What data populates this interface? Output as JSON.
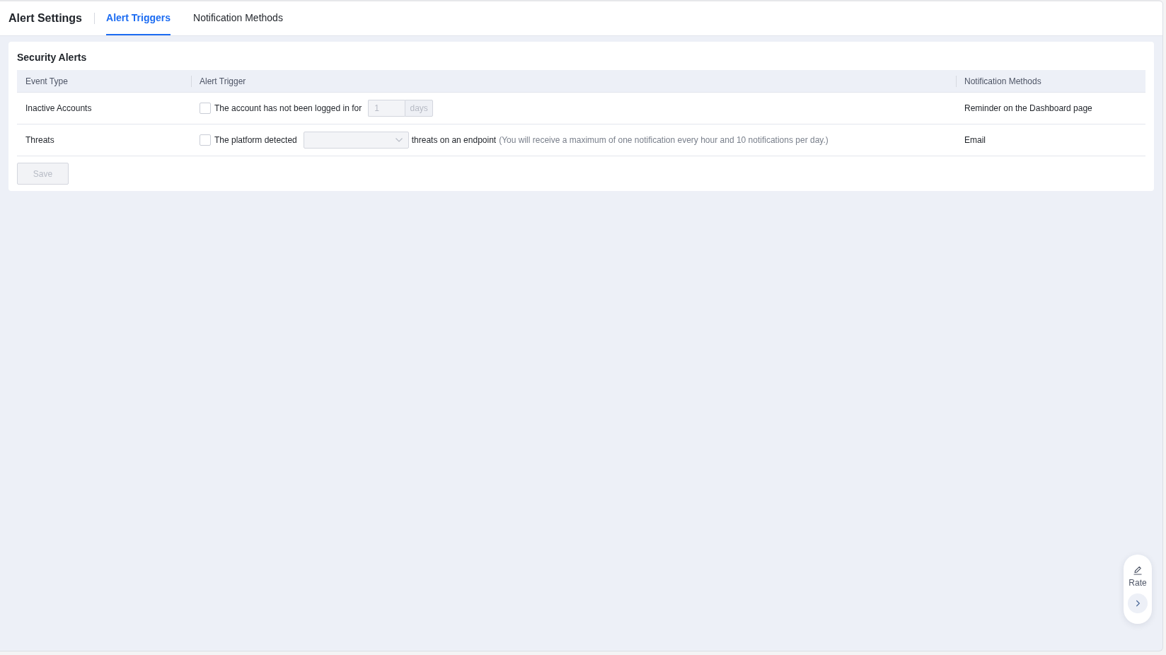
{
  "header": {
    "title": "Alert Settings",
    "tabs": [
      {
        "label": "Alert Triggers",
        "selected": true
      },
      {
        "label": "Notification Methods",
        "selected": false
      }
    ]
  },
  "card": {
    "title": "Security Alerts",
    "table": {
      "columns": [
        "Event Type",
        "Alert Trigger",
        "Notification Methods"
      ],
      "rows": [
        {
          "event_type": "Inactive Accounts",
          "trigger": {
            "kind": "input",
            "checked": false,
            "label": "The account has not been logged in for",
            "input": {
              "value": "1",
              "disabled": true
            },
            "unit": "days"
          },
          "notification": "Reminder on the Dashboard page"
        },
        {
          "event_type": "Threats",
          "trigger": {
            "kind": "select",
            "checked": false,
            "label": "The platform detected",
            "select": {
              "disabled": true
            },
            "suffix": "threats on an endpoint",
            "note": "(You will receive a maximum of one notification every hour and 10 notifications per day.)"
          },
          "notification": "Email"
        }
      ]
    },
    "save_button": {
      "label": "Save",
      "disabled": true
    }
  },
  "rate_widget": {
    "label": "Rate"
  }
}
